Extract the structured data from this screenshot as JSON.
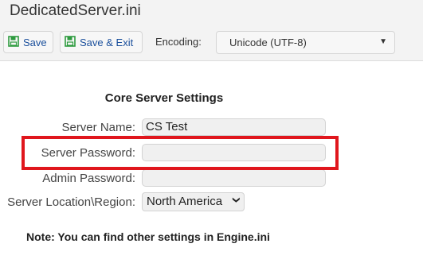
{
  "window": {
    "title": "DedicatedServer.ini"
  },
  "toolbar": {
    "save_label": "Save",
    "save_exit_label": "Save & Exit",
    "encoding_label": "Encoding:",
    "encoding_value": "Unicode (UTF-8)",
    "save_icon": "floppy-disk-icon",
    "icon_color": "#2e9b3f"
  },
  "form": {
    "section_title": "Core Server Settings",
    "server_name_label": "Server Name:",
    "server_name_value": "CS Test",
    "server_password_label": "Server Password:",
    "server_password_value": "",
    "admin_password_label": "Admin Password:",
    "admin_password_value": "",
    "region_label": "Server Location\\Region:",
    "region_value": "North America"
  },
  "note": "Note: You can find other settings in Engine.ini",
  "colors": {
    "highlight": "#e0161d",
    "link_text": "#1a4f9c"
  }
}
